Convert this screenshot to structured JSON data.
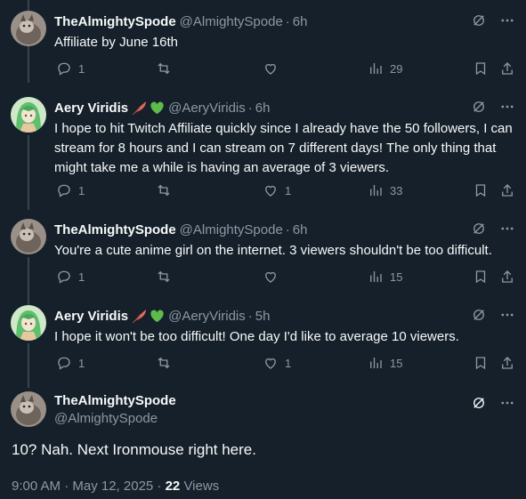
{
  "thread": [
    {
      "author": "TheAlmightySpode",
      "handle": "@AlmightySpode",
      "time": "6h",
      "avatar": "cat",
      "text": "Affiliate by June 16th",
      "replies": "1",
      "retweets": "",
      "likes": "",
      "views": "29"
    },
    {
      "author": "Aery Viridis",
      "handle": "@AeryViridis",
      "time": "6h",
      "avatar": "anime",
      "text": "I hope to hit Twitch Affiliate quickly since I already have the 50 followers, I can stream for 8 hours and I can stream on 7 different days! The only thing that might take me a while is having an average of 3 viewers.",
      "replies": "1",
      "retweets": "",
      "likes": "1",
      "views": "33"
    },
    {
      "author": "TheAlmightySpode",
      "handle": "@AlmightySpode",
      "time": "6h",
      "avatar": "cat",
      "text": "You're a cute anime girl on the internet. 3 viewers shouldn't be too difficult.",
      "replies": "1",
      "retweets": "",
      "likes": "",
      "views": "15"
    },
    {
      "author": "Aery Viridis",
      "handle": "@AeryViridis",
      "time": "5h",
      "avatar": "anime",
      "text": "I hope it won't be too difficult! One day I'd like to average 10 viewers.",
      "replies": "1",
      "retweets": "",
      "likes": "1",
      "views": "15"
    }
  ],
  "main": {
    "author": "TheAlmightySpode",
    "handle": "@AlmightySpode",
    "text": "10? Nah. Next Ironmouse right here.",
    "timestamp": "9:00 AM · May 12, 2025 · ",
    "views_count": "22",
    "views_label": " Views"
  },
  "colors": {
    "background": "#15202b",
    "text": "#f7f9f9",
    "muted": "#8b98a5",
    "thread_line": "#38444d"
  },
  "icons": [
    "grok-icon",
    "more-icon",
    "reply-icon",
    "retweet-icon",
    "like-icon",
    "views-icon",
    "bookmark-icon",
    "share-icon",
    "feather-emoji",
    "green-heart-emoji"
  ]
}
